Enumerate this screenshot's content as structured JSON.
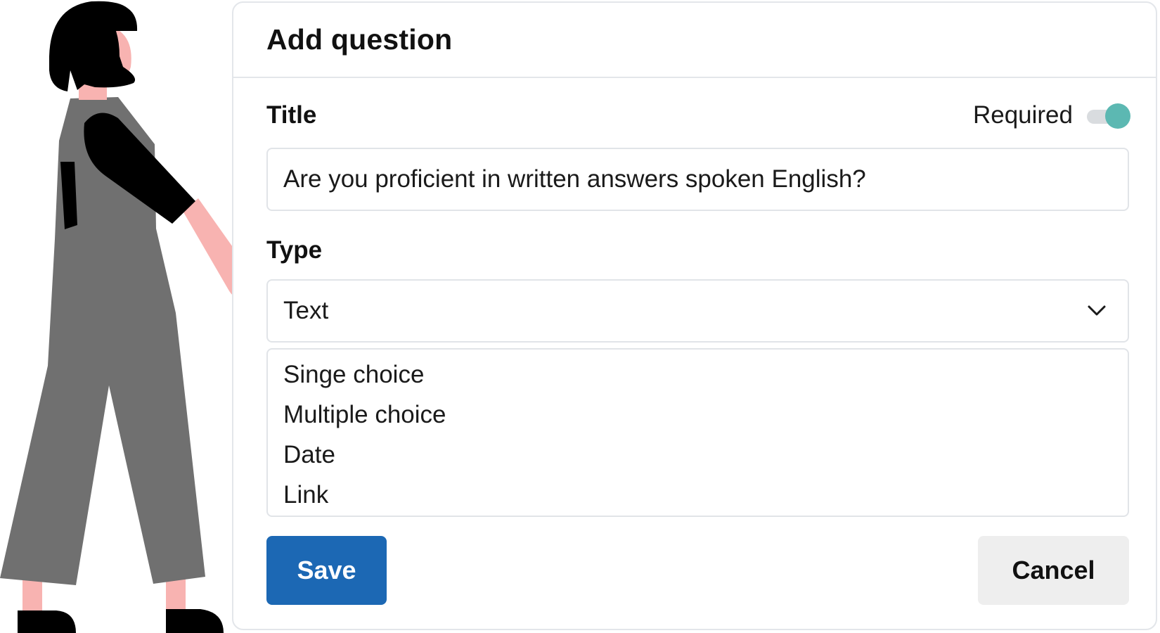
{
  "dialog": {
    "title": "Add question",
    "title_field": {
      "label": "Title",
      "value": "Are you proficient in written answers spoken English?"
    },
    "required": {
      "label": "Required",
      "checked": true,
      "accent_color": "#5cb8b2"
    },
    "type_field": {
      "label": "Type",
      "selected": "Text",
      "options": [
        "Singe choice",
        "Multiple choice",
        "Date",
        "Link"
      ]
    },
    "buttons": {
      "save_label": "Save",
      "cancel_label": "Cancel",
      "save_color": "#1c68b4"
    }
  },
  "illustration": {
    "subject": "person-standing",
    "colors": {
      "hair": "#000000",
      "skin": "#f8b3b1",
      "overalls": "#707070",
      "shirt": "#000000",
      "shoes": "#000000"
    }
  }
}
